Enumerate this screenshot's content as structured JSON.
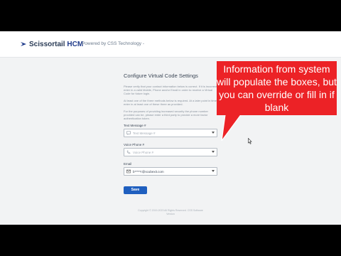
{
  "header": {
    "brand_name": "Scissortail",
    "brand_suffix": "HCM",
    "powered_by": "- Powered by CSS Technology -"
  },
  "settings": {
    "title": "Configure Virtual Code Settings",
    "para1": "Please verify that your contact information below is correct. If it is incorrect, enter in a valid Mobile, Phone and/or Email in order to receive a Virtual Code for future login.",
    "para2": "At least one of the three methods below is required. At a later point in time, enter in at least one of these three as provided.",
    "para3": "For the purposes of providing increased security the phone number provided can be, please enter a third party to provide a more factor authentication token.",
    "text_label": "Text Message #",
    "text_placeholder": "Text Message #",
    "voice_label": "Voice Phone #",
    "voice_placeholder": "Voice Phone #",
    "email_label": "Email",
    "email_value": "b*****r@scubexit.com",
    "save_label": "Save",
    "copyright": "Copyright © 2019-2023 All Rights Reserved. CSS Software Version"
  },
  "callout": {
    "text": "Information from system will populate the boxes, but you can override or fill in if blank",
    "color": "#ec2226"
  },
  "colors": {
    "save_button": "#1f5fbf",
    "background": "#f2f3f4"
  }
}
